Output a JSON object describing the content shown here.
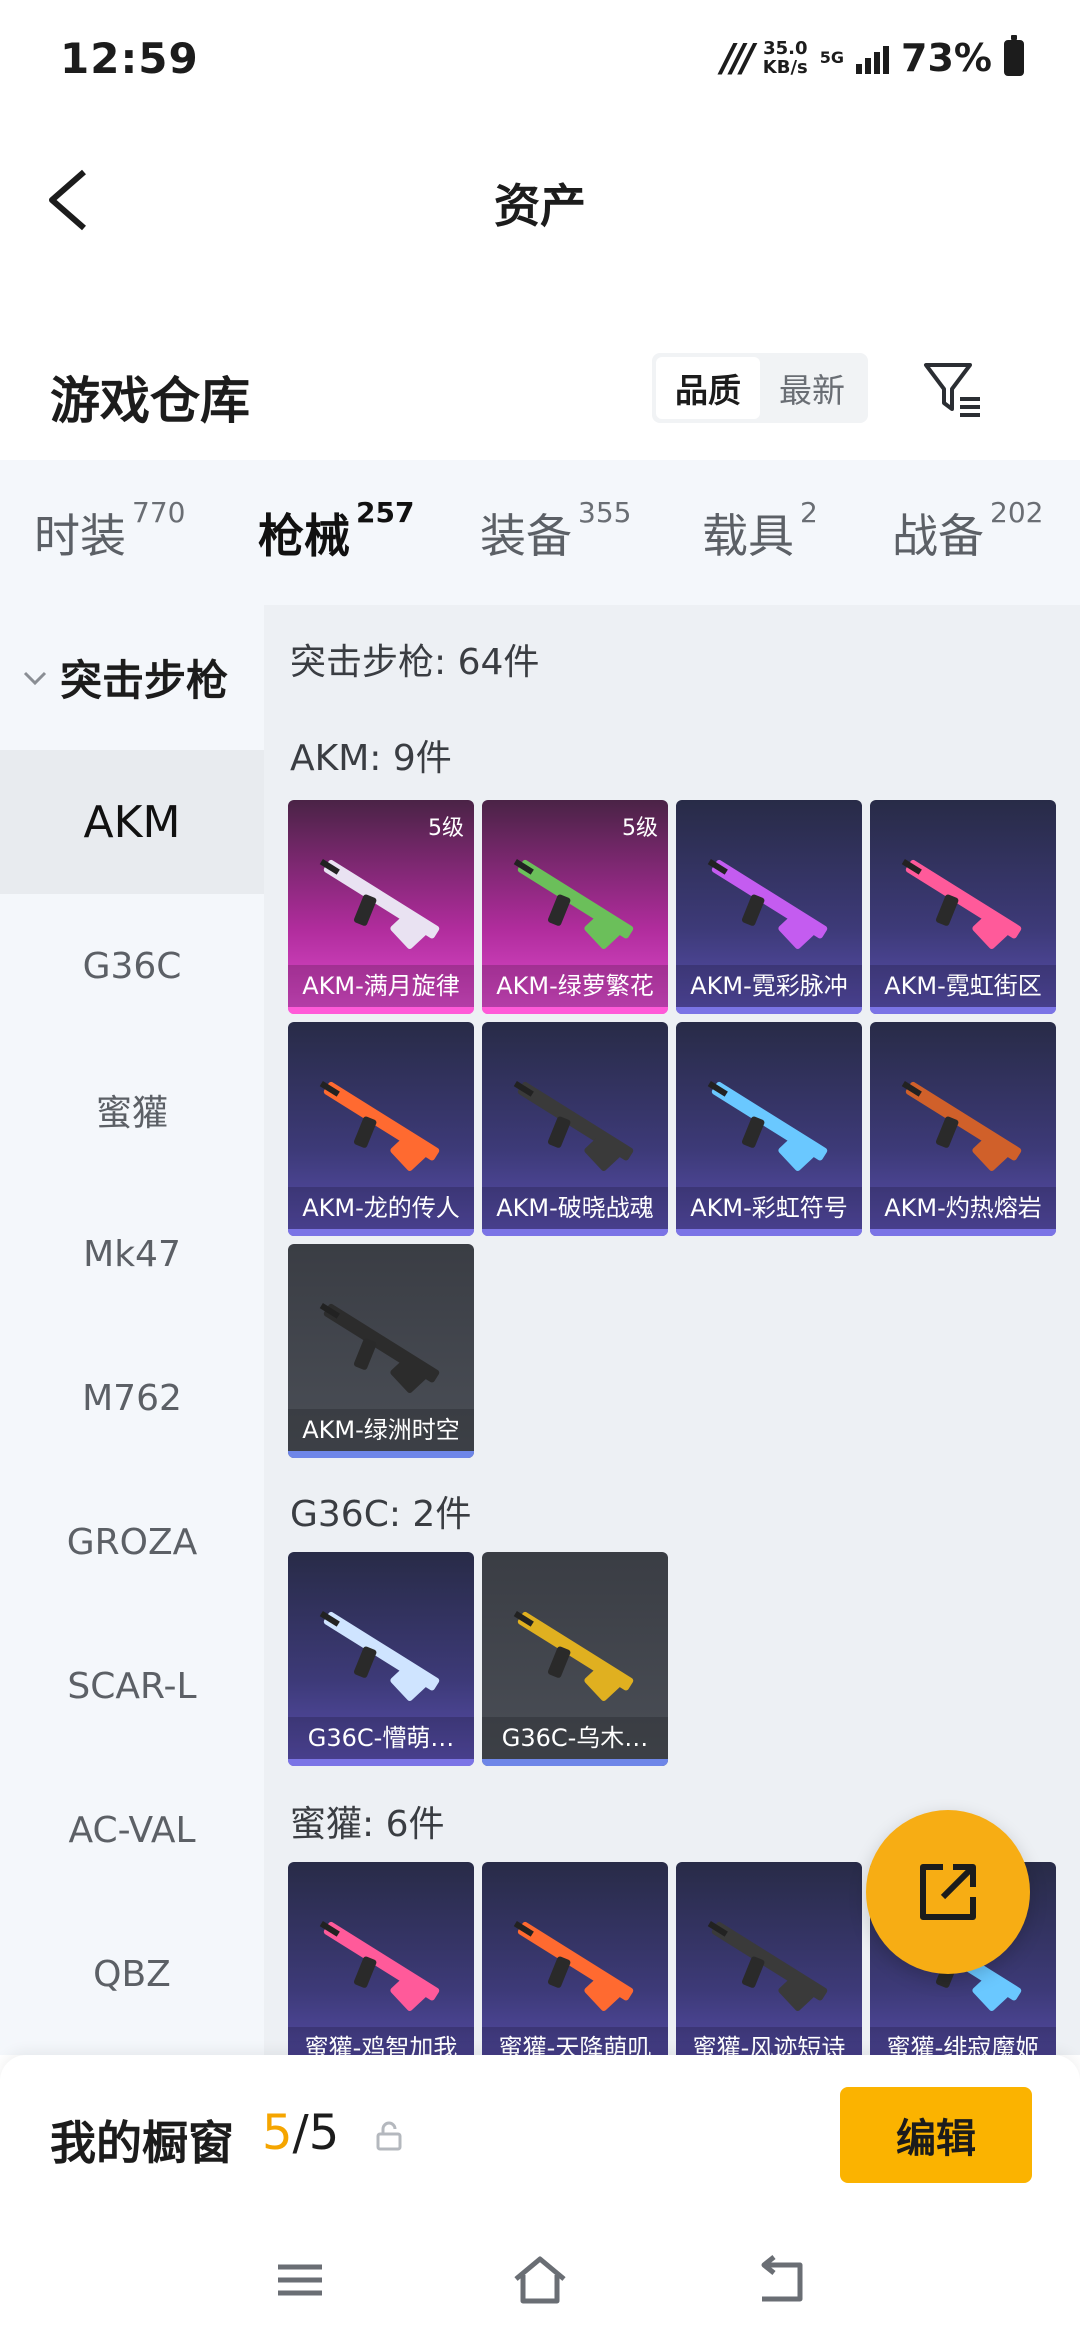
{
  "status": {
    "time": "12:59",
    "speed_value": "35.0",
    "speed_unit": "KB/s",
    "network": "5G",
    "battery": "73%"
  },
  "header": {
    "title": "资产"
  },
  "warehouse": {
    "title": "游戏仓库",
    "sort_options": [
      "品质",
      "最新"
    ],
    "active_sort": "品质"
  },
  "categories": [
    {
      "label": "时装",
      "count": "770"
    },
    {
      "label": "枪械",
      "count": "257"
    },
    {
      "label": "装备",
      "count": "355"
    },
    {
      "label": "载具",
      "count": "2"
    },
    {
      "label": "战备",
      "count": "202"
    }
  ],
  "sidebar": {
    "group": "突击步枪",
    "items": [
      "AKM",
      "G36C",
      "蜜獾",
      "Mk47",
      "M762",
      "GROZA",
      "SCAR-L",
      "AC-VAL",
      "QBZ"
    ]
  },
  "content": {
    "summary": "突击步枪: 64件",
    "sections": [
      {
        "header": "AKM: 9件",
        "items": [
          {
            "name": "AKM-满月旋律",
            "level": "5级",
            "tier": "pink"
          },
          {
            "name": "AKM-绿萝繁花",
            "level": "5级",
            "tier": "pink"
          },
          {
            "name": "AKM-霓彩脉冲",
            "tier": "purple"
          },
          {
            "name": "AKM-霓虹街区",
            "tier": "purple"
          },
          {
            "name": "AKM-龙的传人",
            "tier": "purple"
          },
          {
            "name": "AKM-破晓战魂",
            "tier": "purple"
          },
          {
            "name": "AKM-彩虹符号",
            "tier": "purple"
          },
          {
            "name": "AKM-灼热熔岩",
            "tier": "purple"
          },
          {
            "name": "AKM-绿洲时空",
            "tier": "gray"
          }
        ]
      },
      {
        "header": "G36C: 2件",
        "items": [
          {
            "name": "G36C-懵萌…",
            "tier": "purple"
          },
          {
            "name": "G36C-乌木…",
            "tier": "gray"
          }
        ]
      },
      {
        "header": "蜜獾: 6件",
        "items": [
          {
            "name": "蜜獾-鸡智加我",
            "tier": "purple"
          },
          {
            "name": "蜜獾-天降萌叽",
            "tier": "purple"
          },
          {
            "name": "蜜獾-风迹短诗",
            "tier": "purple"
          },
          {
            "name": "蜜獾-绯寂魔姬",
            "tier": "purple"
          }
        ]
      }
    ]
  },
  "showcase": {
    "title": "我的橱窗",
    "current": "5",
    "total": "/5",
    "edit_label": "编辑"
  },
  "colors": {
    "accent": "#f5a500",
    "edit_button": "#fbb300",
    "fab": "#f7ad14",
    "tier_pink": "#e04ed0",
    "tier_purple": "#5a4fb0",
    "tier_gray": "#4b4f57"
  }
}
